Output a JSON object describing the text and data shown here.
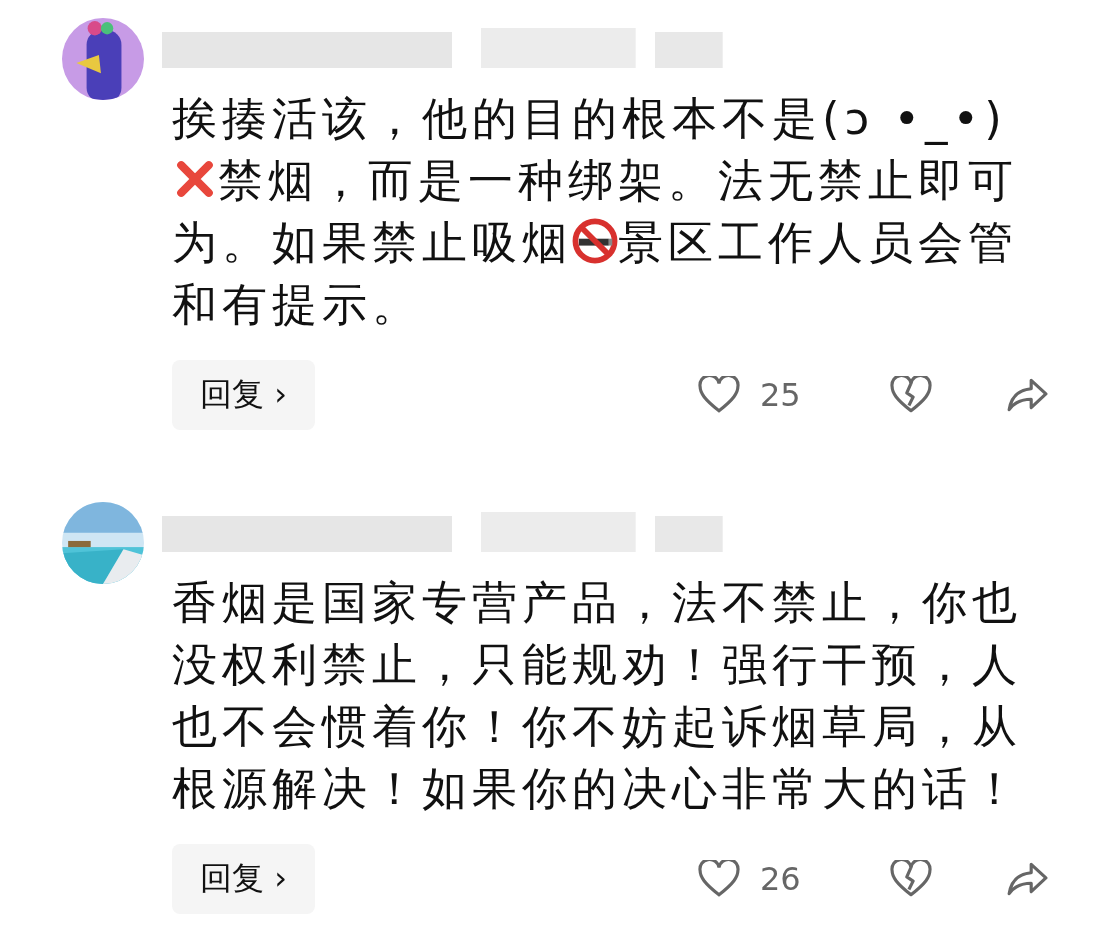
{
  "comments": [
    {
      "avatar": {
        "kind": "picture"
      },
      "body": [
        {
          "kind": "text",
          "text": "挨揍活该，他的目的根本不是(ɔ •_•)"
        },
        {
          "kind": "cross"
        },
        {
          "kind": "text",
          "text": "禁烟，而是一种绑架。法无禁止即可为。如果禁止吸烟"
        },
        {
          "kind": "no-smoking"
        },
        {
          "kind": "text",
          "text": "景区工作人员会管和有提示。"
        }
      ],
      "reply": "回复 ›",
      "likes": "25"
    },
    {
      "avatar": {
        "kind": "picture"
      },
      "body": [
        {
          "kind": "text",
          "text": "香烟是国家专营产品，法不禁止，你也没权利禁止，只能规劝！强行干预，人也不会惯着你！你不妨起诉烟草局，从根源解决！如果你的决心非常大的话！"
        }
      ],
      "reply": "回复 ›",
      "likes": "26"
    }
  ]
}
